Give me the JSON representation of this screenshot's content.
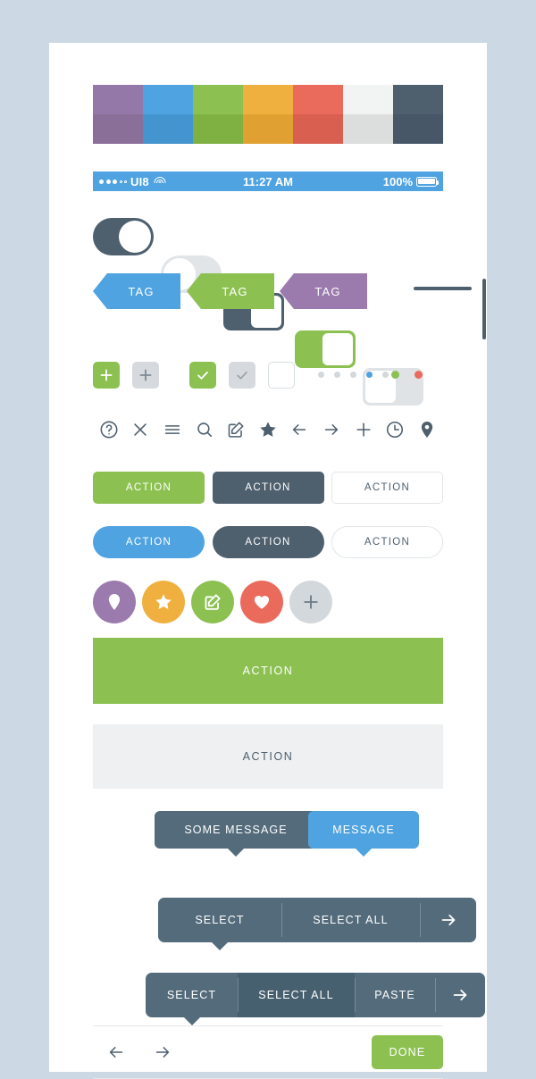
{
  "page": {
    "background": "#ccd9e5",
    "card_background": "#ffffff"
  },
  "palette": {
    "swatches": [
      {
        "name": "purple",
        "top": "#9478a8",
        "bottom": "#8a6f99"
      },
      {
        "name": "blue",
        "top": "#4fa3e0",
        "bottom": "#4394cf"
      },
      {
        "name": "green",
        "top": "#8cc152",
        "bottom": "#7fb042"
      },
      {
        "name": "orange",
        "top": "#f0b03f",
        "bottom": "#e0a132"
      },
      {
        "name": "red",
        "top": "#ea6a5b",
        "bottom": "#d95f51"
      },
      {
        "name": "white",
        "top": "#f2f3f3",
        "bottom": "#dcdddd"
      },
      {
        "name": "slate",
        "top": "#4e5f6e",
        "bottom": "#475768"
      }
    ]
  },
  "statusbar": {
    "carrier": "UI8",
    "signal_dots": [
      true,
      true,
      true,
      false,
      false
    ],
    "wifi_icon": "wifi-icon",
    "time": "11:27 AM",
    "battery_percent": "100%",
    "battery_icon": "battery-full-icon",
    "background": "#4fa3e0"
  },
  "toggles": [
    {
      "name": "toggle-pill-on-dark",
      "shape": "pill",
      "state": "on",
      "track": "#4e5f6e",
      "knob": "#ffffff",
      "border": "none"
    },
    {
      "name": "toggle-pill-off",
      "shape": "pill",
      "state": "off",
      "track": "#e1e5e8",
      "knob": "#ffffff",
      "border": "none"
    },
    {
      "name": "toggle-rect-on-dark",
      "shape": "rect",
      "state": "on",
      "track": "#4e5f6e",
      "knob": "#ffffff",
      "border": "none"
    },
    {
      "name": "toggle-rect-on-green",
      "shape": "rect",
      "state": "on",
      "track": "#8cc152",
      "knob": "#ffffff",
      "border": "none"
    },
    {
      "name": "toggle-rect-off",
      "shape": "rect",
      "state": "off",
      "track": "#dfe3e6",
      "knob": "#ffffff",
      "border": "none"
    }
  ],
  "tags": [
    {
      "label": "TAG",
      "color": "#4fa3e0"
    },
    {
      "label": "TAG",
      "color": "#8cc152"
    },
    {
      "label": "TAG",
      "color": "#9b7aad"
    }
  ],
  "rules": {
    "horizontal_color": "#4e5f6e",
    "vertical_color": "#4e5f6e"
  },
  "checks": [
    {
      "name": "checkbox-plus-green",
      "icon": "plus-icon",
      "bg": "#8cc152",
      "fg": "#ffffff",
      "border": "none"
    },
    {
      "name": "checkbox-plus-gray",
      "icon": "plus-icon",
      "bg": "#d6dade",
      "fg": "#7c8a95",
      "border": "none"
    },
    {
      "name": "checkbox-check-green",
      "icon": "check-icon",
      "bg": "#8cc152",
      "fg": "#ffffff",
      "border": "none"
    },
    {
      "name": "checkbox-check-gray",
      "icon": "check-icon",
      "bg": "#d6dade",
      "fg": "#9aa5ad",
      "border": "none"
    },
    {
      "name": "checkbox-empty",
      "icon": "none",
      "bg": "#ffffff",
      "fg": "#ffffff",
      "border": "#d8dde1"
    }
  ],
  "page_dots": {
    "count": 5,
    "active_index": 3,
    "inactive_color": "#d3d8dc",
    "active_color": "#4fa3e0"
  },
  "status_dots": [
    {
      "name": "status-dot-green",
      "color": "#8cc152"
    },
    {
      "name": "status-dot-red",
      "color": "#ea6a5b"
    }
  ],
  "icon_row": {
    "color": "#4e5f6e",
    "icons": [
      "help-icon",
      "close-icon",
      "menu-icon",
      "search-icon",
      "compose-icon",
      "star-icon",
      "arrow-left-icon",
      "arrow-right-icon",
      "plus-icon",
      "clock-icon",
      "location-icon"
    ]
  },
  "buttons_row1": [
    {
      "label": "ACTION",
      "bg": "#8cc152",
      "fg": "#ffffff",
      "border": "none",
      "radius": "5px"
    },
    {
      "label": "ACTION",
      "bg": "#4e5f6e",
      "fg": "#ffffff",
      "border": "none",
      "radius": "5px"
    },
    {
      "label": "ACTION",
      "bg": "#ffffff",
      "fg": "#4e5f6e",
      "border": "#e2e6e9",
      "radius": "5px"
    }
  ],
  "buttons_row2": [
    {
      "label": "ACTION",
      "bg": "#4fa3e0",
      "fg": "#ffffff",
      "border": "none",
      "radius": "18px"
    },
    {
      "label": "ACTION",
      "bg": "#4e5f6e",
      "fg": "#ffffff",
      "border": "none",
      "radius": "18px"
    },
    {
      "label": "ACTION",
      "bg": "#ffffff",
      "fg": "#4e5f6e",
      "border": "#e2e6e9",
      "radius": "18px"
    }
  ],
  "circle_buttons": [
    {
      "name": "circle-button-location",
      "icon": "location-icon",
      "bg": "#9b7aad",
      "fg": "#ffffff"
    },
    {
      "name": "circle-button-star",
      "icon": "star-icon",
      "bg": "#f0b03f",
      "fg": "#ffffff"
    },
    {
      "name": "circle-button-compose",
      "icon": "compose-icon",
      "bg": "#8cc152",
      "fg": "#ffffff"
    },
    {
      "name": "circle-button-heart",
      "icon": "heart-icon",
      "bg": "#ea6a5b",
      "fg": "#ffffff"
    },
    {
      "name": "circle-button-plus",
      "icon": "plus-icon",
      "bg": "#d3d8dc",
      "fg": "#6b7a86"
    }
  ],
  "banners": {
    "primary": {
      "label": "ACTION",
      "bg": "#8cc152",
      "fg": "#ffffff"
    },
    "secondary": {
      "label": "ACTION",
      "bg": "#eef0f1",
      "fg": "#4e5f6e"
    }
  },
  "tooltips": [
    {
      "name": "tooltip-some-message",
      "label": "SOME MESSAGE",
      "bg": "#536b7b"
    },
    {
      "name": "tooltip-message",
      "label": "MESSAGE",
      "bg": "#4fa3e0"
    }
  ],
  "toolbar_1": {
    "background": "#536b7b",
    "segments": [
      {
        "label": "SELECT",
        "width": 138,
        "active": false
      },
      {
        "label": "SELECT ALL",
        "width": 155,
        "active": false
      },
      {
        "label": "",
        "width": 63,
        "active": false,
        "icon": "arrow-right-icon"
      }
    ]
  },
  "toolbar_2": {
    "background": "#536b7b",
    "active_background": "#47606f",
    "segments": [
      {
        "label": "SELECT",
        "width": 103,
        "active": false
      },
      {
        "label": "SELECT ALL",
        "width": 131,
        "active": true
      },
      {
        "label": "PASTE",
        "width": 90,
        "active": false
      },
      {
        "label": "",
        "width": 56,
        "active": false,
        "icon": "arrow-right-icon"
      }
    ]
  },
  "bottom_bar": {
    "back_icon": "arrow-left-icon",
    "forward_icon": "arrow-right-icon",
    "icon_color": "#4e5f6e",
    "done_label": "DONE",
    "done_bg": "#8cc152"
  }
}
